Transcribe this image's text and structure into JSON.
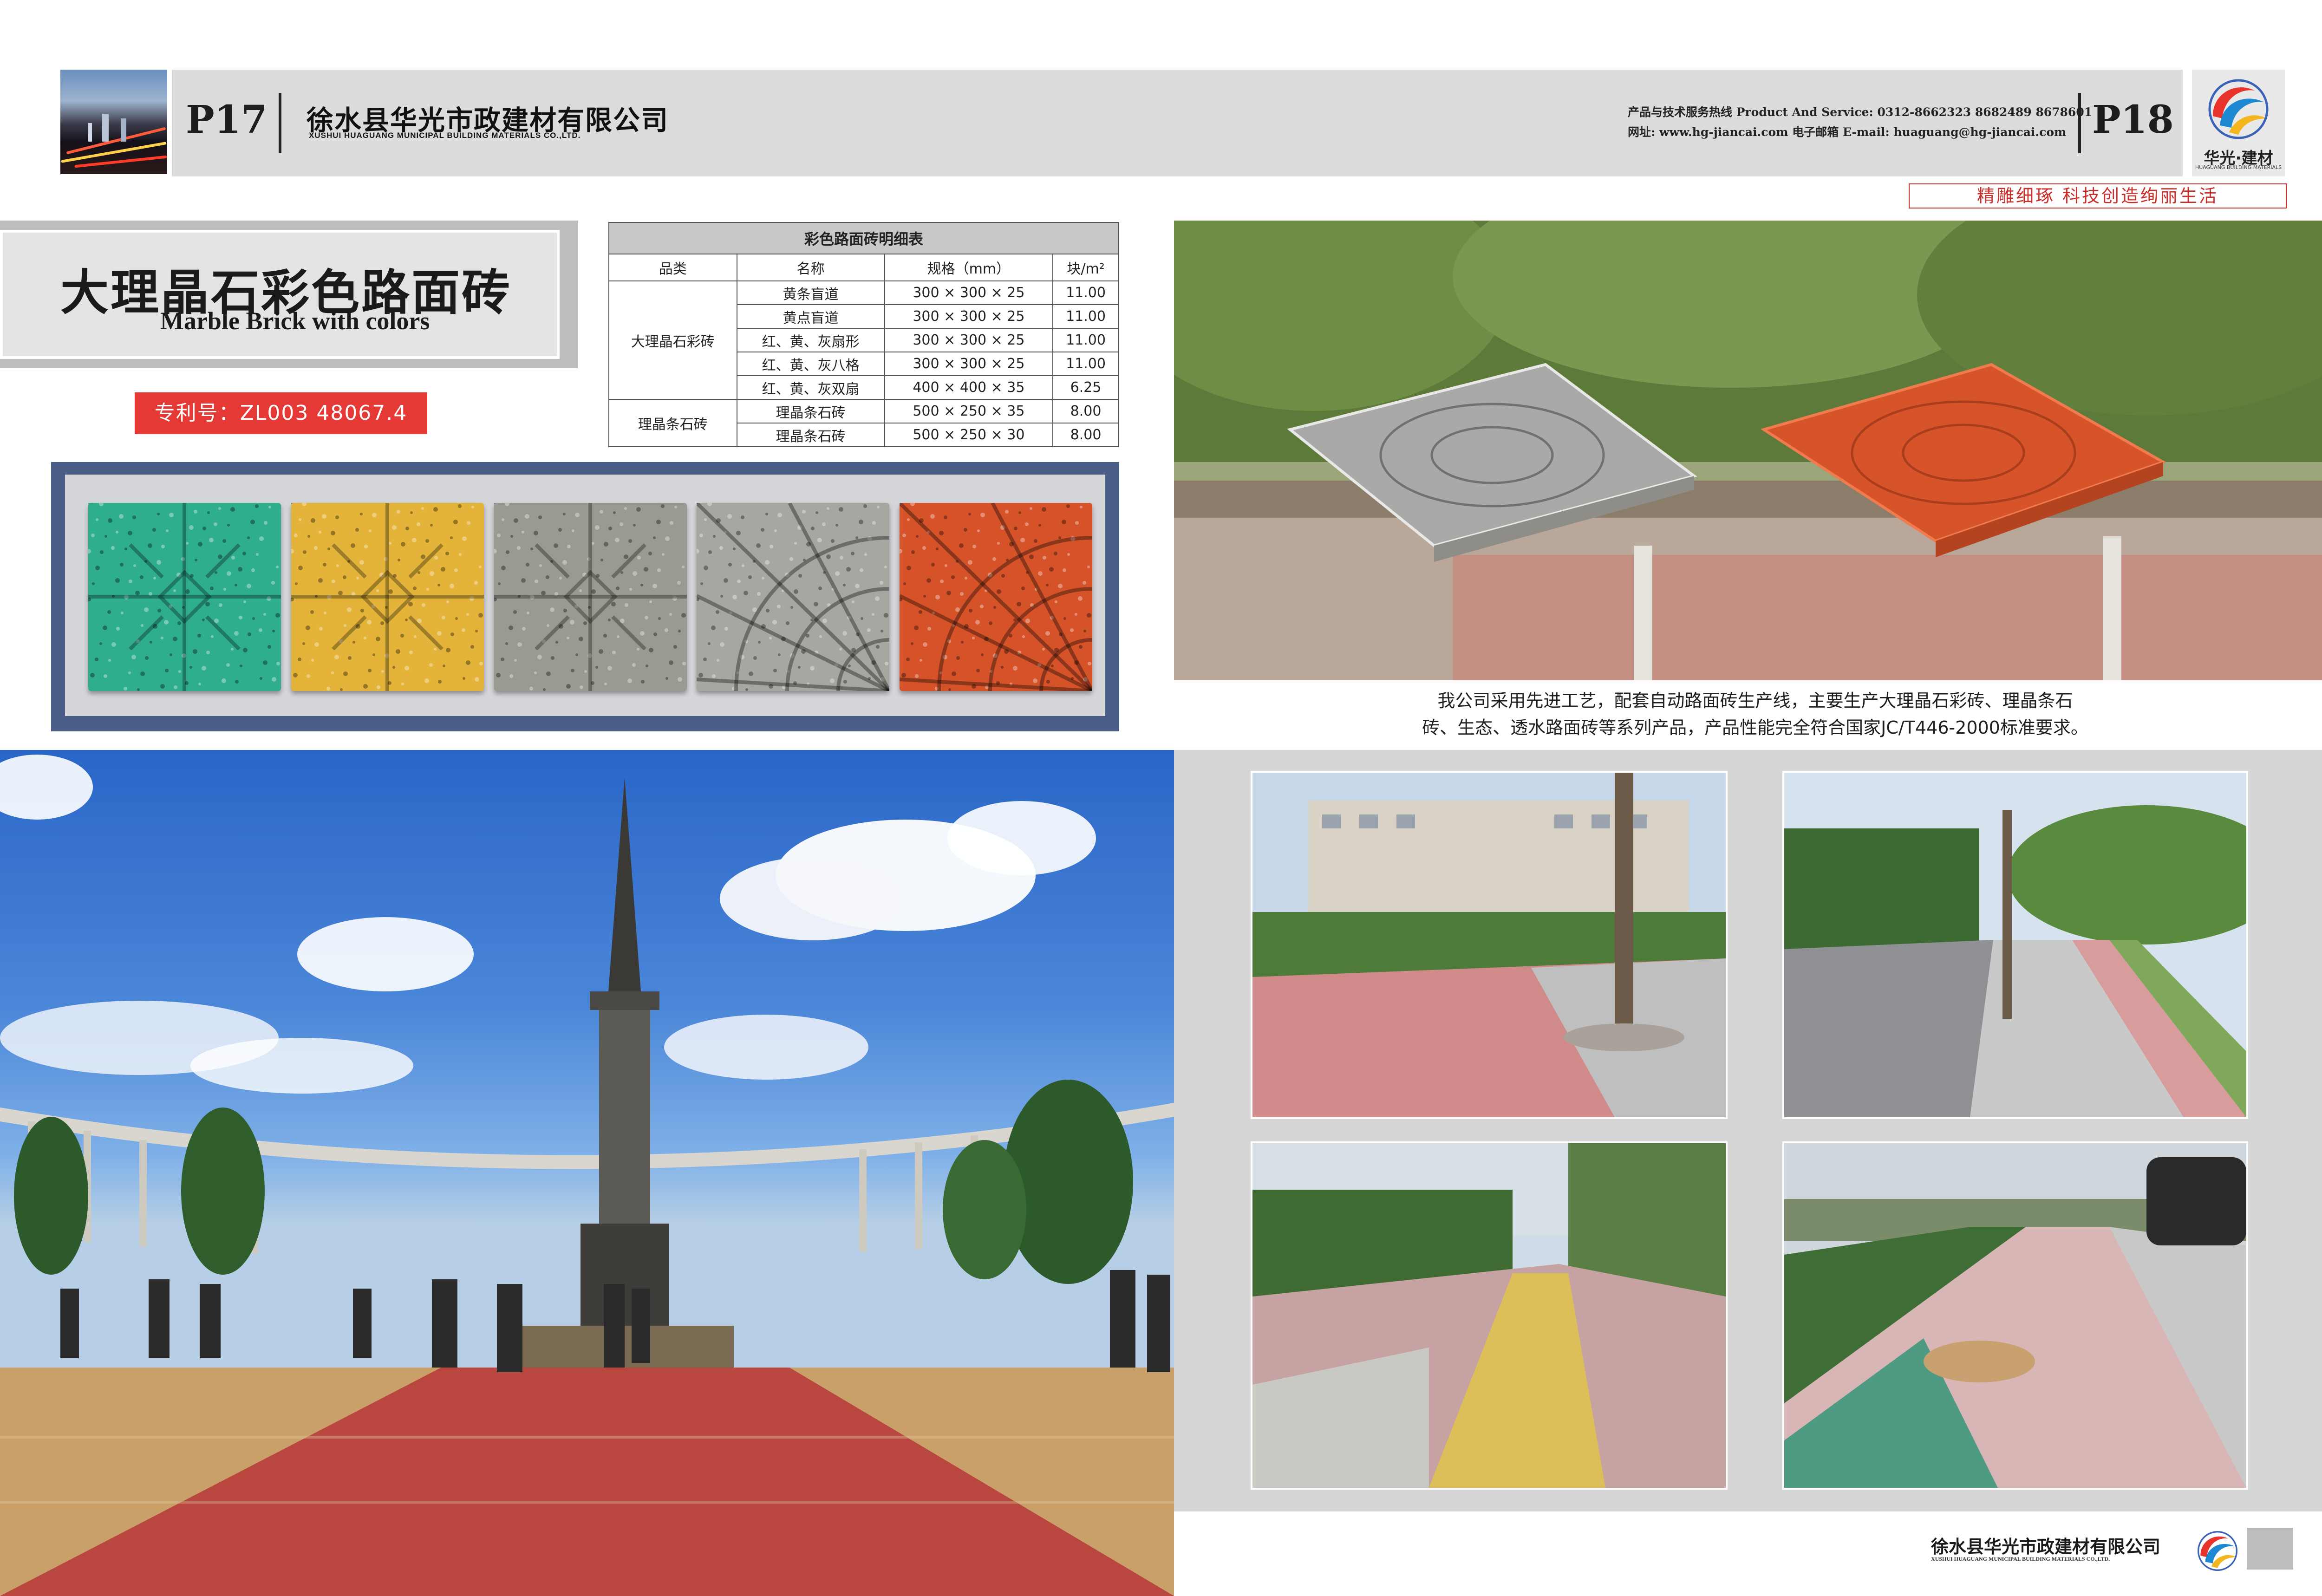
{
  "header": {
    "left_page": "P17",
    "right_page": "P18",
    "company_cn": "徐水县华光市政建材有限公司",
    "company_en": "XUSHUI HUAGUANG MUNICIPAL BUILDING MATERIALS CO.,LTD.",
    "hotline": "产品与技术服务热线 Product And Service: 0312-8662323  8682489  8678601",
    "web_email": "网址: www.hg-jiancai.com  电子邮箱 E-mail: huaguang@hg-jiancai.com",
    "logo_text": "华光·建材",
    "logo_sub": "HUAGUANG BUILDING MATERIALS",
    "slogan": "精雕细琢  科技创造绚丽生活"
  },
  "title": {
    "cn": "大理晶石彩色路面砖",
    "en": "Marble Brick with colors",
    "patent": "专利号：ZL003 48067.4"
  },
  "spec_table": {
    "caption": "彩色路面砖明细表",
    "headers": [
      "品类",
      "名称",
      "规格（mm）",
      "块/m²"
    ],
    "groups": [
      {
        "category": "大理晶石彩砖",
        "rows": [
          [
            "黄条盲道",
            "300 × 300 × 25",
            "11.00"
          ],
          [
            "黄点盲道",
            "300 × 300 × 25",
            "11.00"
          ],
          [
            "红、黄、灰扇形",
            "300 × 300 × 25",
            "11.00"
          ],
          [
            "红、黄、灰八格",
            "300 × 300 × 25",
            "11.00"
          ],
          [
            "红、黄、灰双扇",
            "400 × 400 × 35",
            "6.25"
          ]
        ]
      },
      {
        "category": "理晶条石砖",
        "rows": [
          [
            "理晶条石砖",
            "500 × 250 × 35",
            "8.00"
          ],
          [
            "理晶条石砖",
            "500 × 250 × 30",
            "8.00"
          ]
        ]
      }
    ]
  },
  "tiles": [
    {
      "name": "green-octagon-tile",
      "color": "#2fae8e"
    },
    {
      "name": "yellow-octagon-tile",
      "color": "#e3b33a"
    },
    {
      "name": "gray-octagon-tile",
      "color": "#9a9a90"
    },
    {
      "name": "gray-fan-tile",
      "color": "#a7a7a1"
    },
    {
      "name": "red-fan-tile",
      "color": "#d6532a"
    }
  ],
  "description": "我公司采用先进工艺，配套自动路面砖生产线，主要生产大理晶石彩砖、理晶条石砖、生态、透水路面砖等系列产品，产品性能完全符合国家JC/T446-2000标准要求。",
  "description_line1": "我公司采用先进工艺，配套自动路面砖生产线，主要生产大理晶石彩砖、理晶条石",
  "description_line2": "砖、生态、透水路面砖等系列产品，产品性能完全符合国家JC/T446-2000标准要求。",
  "footer": {
    "company_cn": "徐水县华光市政建材有限公司",
    "company_en": "XUSHUI HUAGUANG MUNICIPAL BUILDING MATERIALS CO.,LTD."
  },
  "colors": {
    "header_gray": "#dcdcdc",
    "accent_red": "#e53935",
    "strip_blue": "#495d86"
  }
}
